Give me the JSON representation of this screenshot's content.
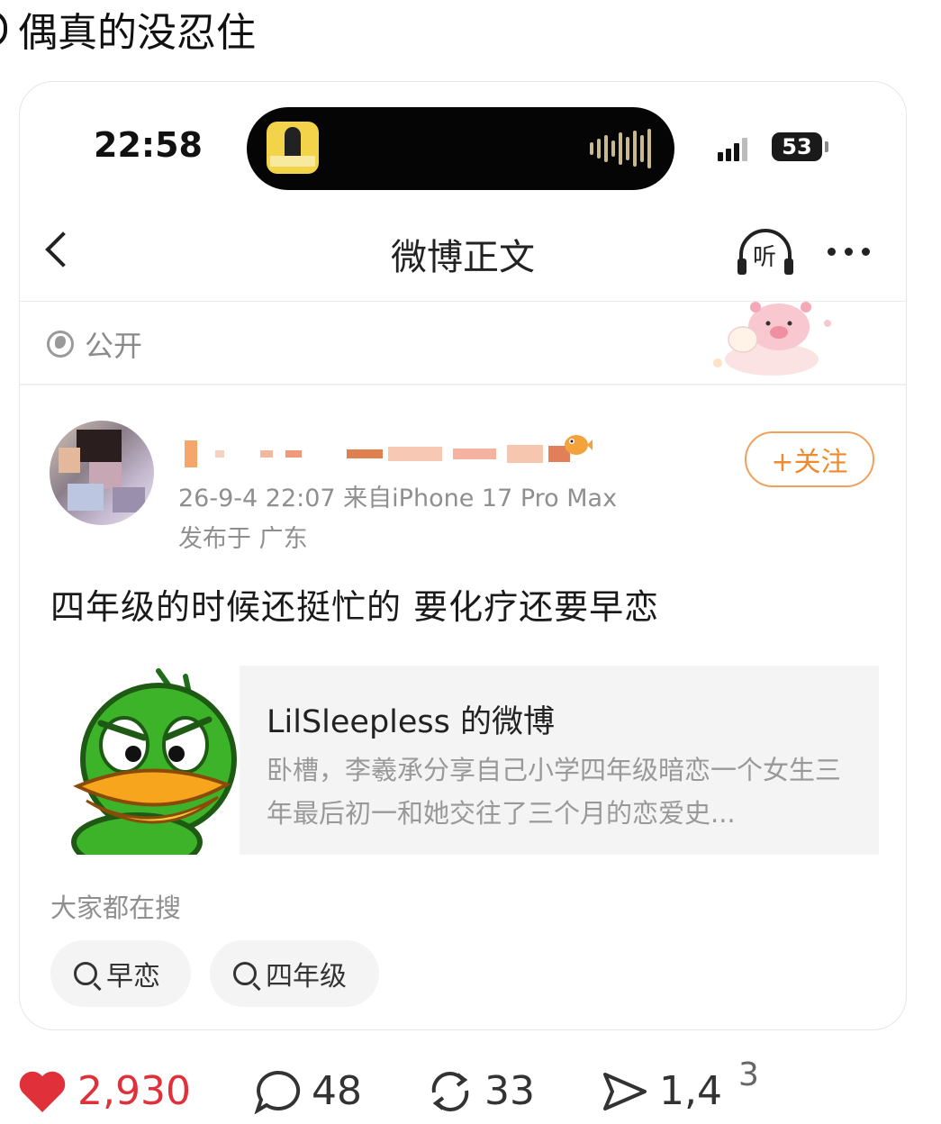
{
  "post_text": "偶真的没忍住",
  "status_bar": {
    "time": "22:58",
    "battery": "53"
  },
  "nav": {
    "title": "微博正文",
    "listen_label": "听"
  },
  "visibility": {
    "label": "公开"
  },
  "author": {
    "meta": "26-9-4 22:07  来自iPhone 17 Pro Max",
    "location": "发布于 广东",
    "follow_label": "+关注"
  },
  "post": {
    "content": "四年级的时候还挺忙的 要化疗还要早恋"
  },
  "embed": {
    "title": "LilSleepless 的微博",
    "description": "卧槽，李羲承分享自己小学四年级暗恋一个女生三年最后初一和她交往了三个月的恋爱史..."
  },
  "hot_search": {
    "label": "大家都在搜",
    "chips": [
      "早恋",
      "四年级"
    ]
  },
  "actions": {
    "likes": "2,930",
    "comments": "48",
    "reposts": "33",
    "shares": "1,4",
    "shares_partial": "3"
  },
  "colors": {
    "accent": "#f08a2e",
    "like": "#e0303a"
  }
}
